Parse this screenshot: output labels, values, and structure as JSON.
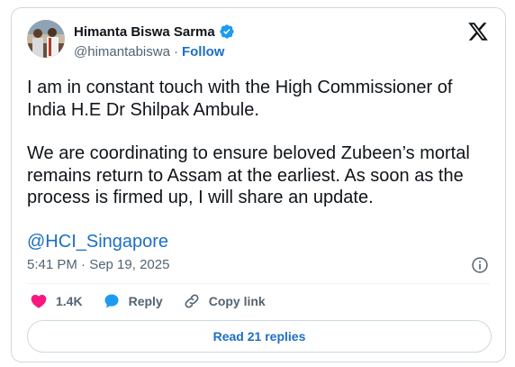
{
  "author": {
    "name": "Himanta Biswa Sarma",
    "handle": "@himantabiswa",
    "separator": "·",
    "follow_label": "Follow",
    "verified_color": "#1d9bf0"
  },
  "tweet": {
    "paragraph1": "I am in constant touch with the High Commissioner of India H.E Dr Shilpak Ambule.",
    "paragraph2": "We are coordinating to ensure beloved Zubeen’s mortal remains return to Assam at the earliest. As soon as the process is firmed up, I will share an update.",
    "mention": "@HCI_Singapore",
    "timestamp": "5:41 PM · Sep 19, 2025"
  },
  "actions": {
    "like_count": "1.4K",
    "reply_label": "Reply",
    "copy_link_label": "Copy link"
  },
  "footer": {
    "read_replies_label": "Read 21 replies"
  },
  "colors": {
    "accent": "#1d6fc4",
    "like": "#f91880",
    "muted": "#536471"
  }
}
